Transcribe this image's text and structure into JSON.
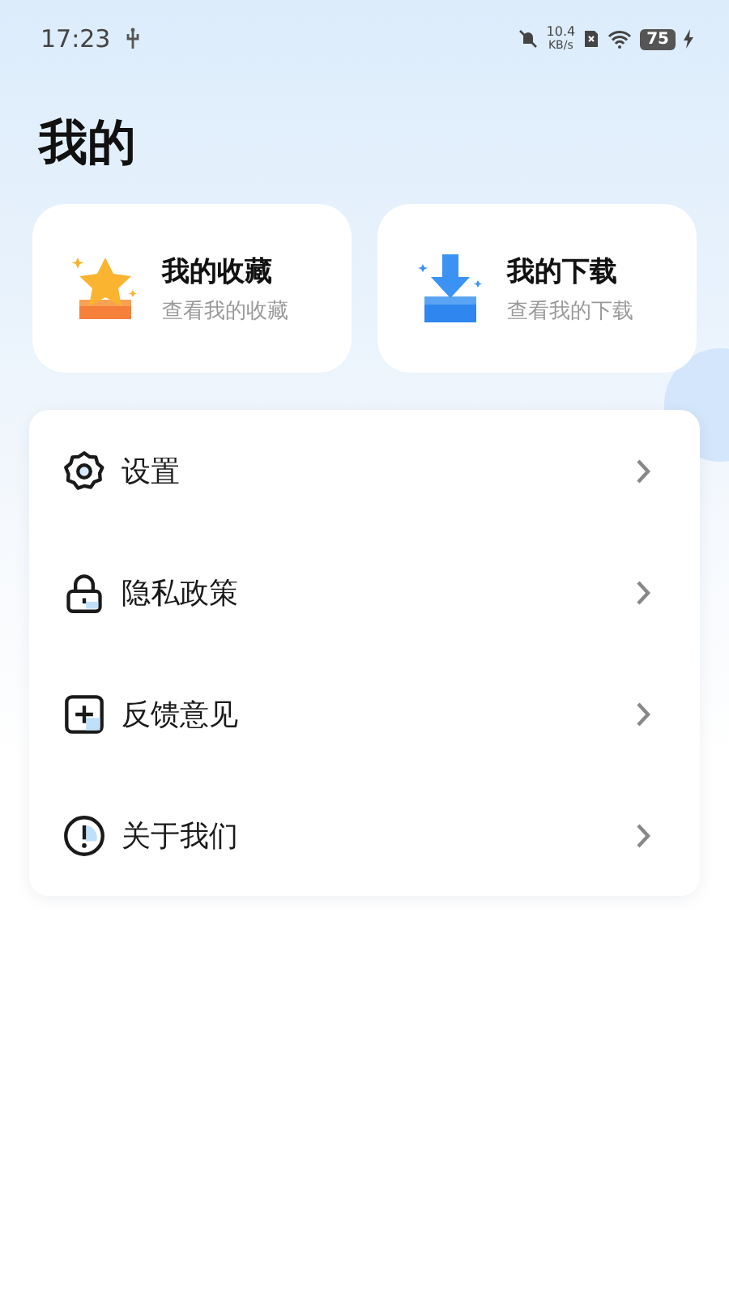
{
  "status_bar": {
    "time": "17:23",
    "net_speed": "10.4",
    "net_unit": "KB/s",
    "battery": "75"
  },
  "title": "我的",
  "quick_cards": [
    {
      "kind": "star",
      "title": "我的收藏",
      "subtitle": "查看我的收藏"
    },
    {
      "kind": "download",
      "title": "我的下载",
      "subtitle": "查看我的下载"
    }
  ],
  "menu": [
    {
      "kind": "gear",
      "label": "设置"
    },
    {
      "kind": "lock",
      "label": "隐私政策"
    },
    {
      "kind": "plus",
      "label": "反馈意见"
    },
    {
      "kind": "info",
      "label": "关于我们"
    }
  ]
}
